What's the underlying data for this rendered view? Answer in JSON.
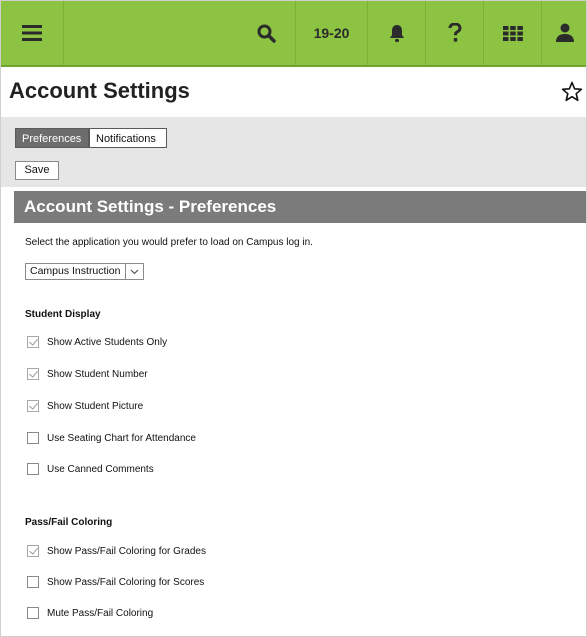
{
  "header": {
    "menu_icon": "hamburger-menu-icon",
    "search_icon": "search-icon",
    "school_year": "19-20",
    "notifications_icon": "bell-icon",
    "help_icon": "question-mark-icon",
    "apps_icon": "app-grid-icon",
    "user_icon": "user-icon",
    "bar_color": "#8cc342"
  },
  "page": {
    "title": "Account Settings",
    "favorite_icon": "star-outline-icon"
  },
  "tabs": [
    {
      "label": "Preferences",
      "active": true
    },
    {
      "label": "Notifications",
      "active": false
    }
  ],
  "toolbar": {
    "save_label": "Save"
  },
  "section": {
    "title": "Account Settings - Preferences",
    "description": "Select the application you would prefer to load on Campus log in.",
    "app_select_value": "Campus Instruction"
  },
  "student_display": {
    "title": "Student Display",
    "options": [
      {
        "label": "Show Active Students Only",
        "checked": true
      },
      {
        "label": "Show Student Number",
        "checked": true
      },
      {
        "label": "Show Student Picture",
        "checked": true
      },
      {
        "label": "Use Seating Chart for Attendance",
        "checked": false
      },
      {
        "label": "Use Canned Comments",
        "checked": false
      }
    ]
  },
  "pass_fail": {
    "title": "Pass/Fail Coloring",
    "options": [
      {
        "label": "Show Pass/Fail Coloring for Grades",
        "checked": true
      },
      {
        "label": "Show Pass/Fail Coloring for Scores",
        "checked": false
      },
      {
        "label": "Mute Pass/Fail Coloring",
        "checked": false
      }
    ]
  }
}
